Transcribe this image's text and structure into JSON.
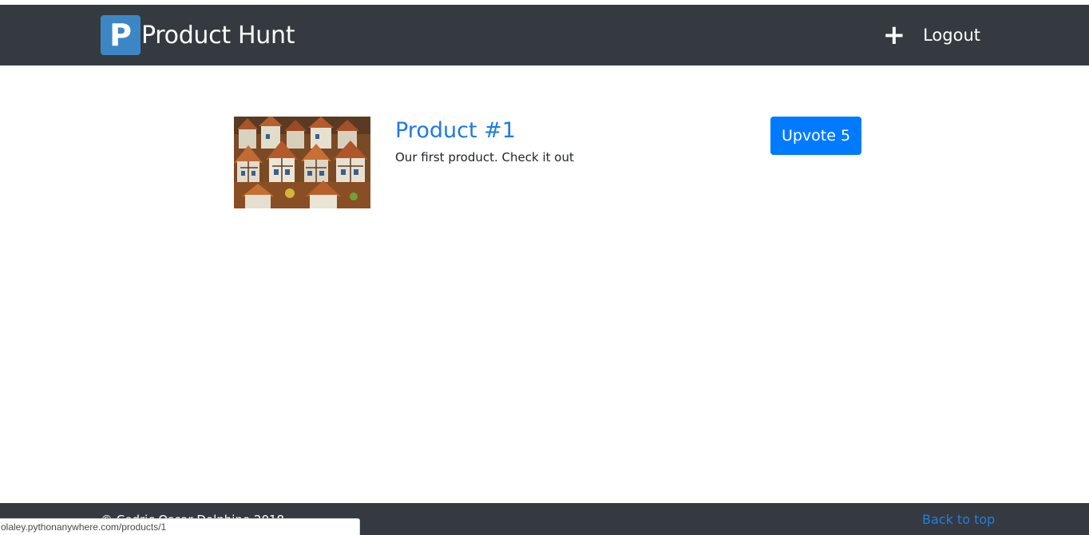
{
  "navbar": {
    "logo_letter": "P",
    "brand": "Product Hunt",
    "add_icon": "plus-icon",
    "logout_label": "Logout",
    "colors": {
      "background": "#343a40",
      "logo": "#3d86c6"
    }
  },
  "products": [
    {
      "title": "Product #1",
      "summary": "Our first product. Check it out",
      "upvote_label": "Upvote 5",
      "image": "photo of colorful half-timbered miniature houses"
    }
  ],
  "footer": {
    "copyright": "© Cedric Oscar Dolphine 2018",
    "back_to_top": "Back to top"
  },
  "status_bar": {
    "url": "olaley.pythonanywhere.com/products/1"
  },
  "colors": {
    "link": "#1f7ae0",
    "button": "#007bff"
  }
}
